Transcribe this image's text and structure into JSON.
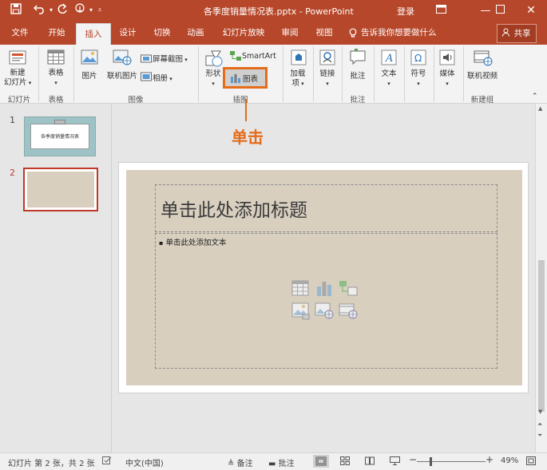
{
  "window": {
    "title": "各季度销量情况表.pptx - PowerPoint",
    "login": "登录",
    "quick_access": [
      "save-icon",
      "undo-icon",
      "redo-icon",
      "touch-icon",
      "customize-icon"
    ]
  },
  "tabs": [
    {
      "label": "文件"
    },
    {
      "label": "开始"
    },
    {
      "label": "插入",
      "active": true
    },
    {
      "label": "设计"
    },
    {
      "label": "切换"
    },
    {
      "label": "动画"
    },
    {
      "label": "幻灯片放映"
    },
    {
      "label": "审阅"
    },
    {
      "label": "视图"
    }
  ],
  "tell_me": "告诉我你想要做什么",
  "share": "共享",
  "ribbon": {
    "new_slide": [
      "新建",
      "幻灯片"
    ],
    "table": "表格",
    "picture": "图片",
    "online_picture": "联机图片",
    "screenshot": "屏幕截图",
    "album": "相册",
    "shapes": "形状",
    "smartart": "SmartArt",
    "chart": "图表",
    "addin": [
      "加载",
      "项"
    ],
    "link": "链接",
    "comment": "批注",
    "text": "文本",
    "symbol": "符号",
    "media": "媒体",
    "online_video": "联机视频",
    "groups": {
      "slides": "幻灯片",
      "tables": "表格",
      "images": "图像",
      "illustrations": "插图",
      "comments": "批注",
      "new_group": "新建组"
    }
  },
  "annotation": "单击",
  "thumbnails": [
    {
      "number": "1",
      "title": "各季度销量情况表"
    },
    {
      "number": "2",
      "title": ""
    }
  ],
  "slide": {
    "title_placeholder": "单击此处添加标题",
    "body_placeholder": "单击此处添加文本"
  },
  "status": {
    "slide_info": "幻灯片 第 2 张，共 2 张",
    "language": "中文(中国)",
    "notes": "备注",
    "comments": "批注",
    "zoom": "49%"
  },
  "colors": {
    "accent": "#b7472a",
    "highlight": "#e46c1a",
    "slide_bg": "#d8cfbf"
  }
}
